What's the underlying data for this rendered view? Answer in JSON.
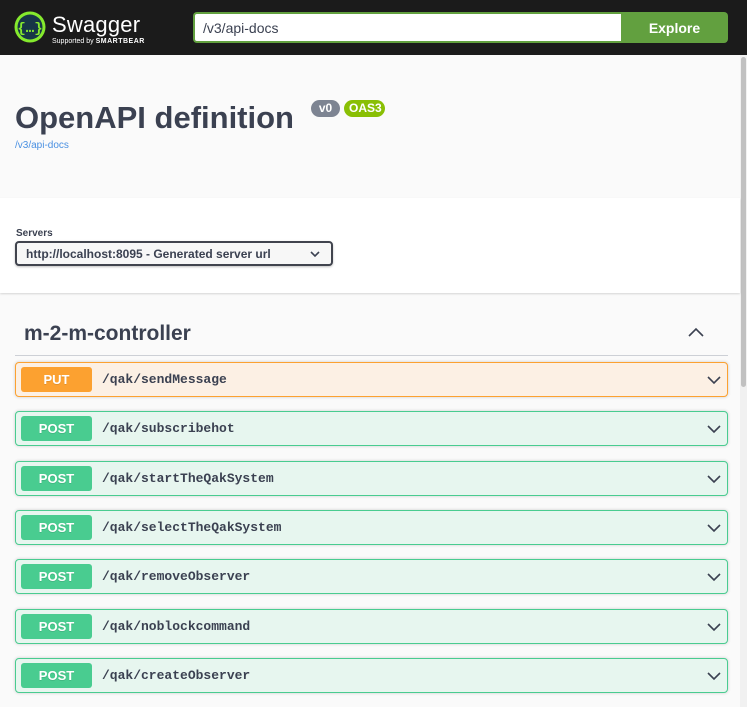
{
  "topbar": {
    "brand_title": "Swagger",
    "brand_sub_prefix": "Supported by",
    "brand_sub_company": "SMARTBEAR",
    "url_value": "/v3/api-docs",
    "explore_label": "Explore",
    "accent_color": "#62a03f"
  },
  "info": {
    "title": "OpenAPI definition",
    "version_badge": "v0",
    "oas_badge": "OAS3",
    "spec_link": "/v3/api-docs"
  },
  "servers": {
    "label": "Servers",
    "selected": "http://localhost:8095 - Generated server url"
  },
  "tag": {
    "name": "m-2-m-controller",
    "expanded": true,
    "toggle_icon": "chevron-up-icon"
  },
  "operations": [
    {
      "method": "PUT",
      "path": "/qak/sendMessage"
    },
    {
      "method": "POST",
      "path": "/qak/subscribehot"
    },
    {
      "method": "POST",
      "path": "/qak/startTheQakSystem"
    },
    {
      "method": "POST",
      "path": "/qak/selectTheQakSystem"
    },
    {
      "method": "POST",
      "path": "/qak/removeObserver"
    },
    {
      "method": "POST",
      "path": "/qak/noblockcommand"
    },
    {
      "method": "POST",
      "path": "/qak/createObserver"
    }
  ],
  "colors": {
    "put": "#fca130",
    "post": "#49cc90",
    "link": "#4990e2"
  }
}
